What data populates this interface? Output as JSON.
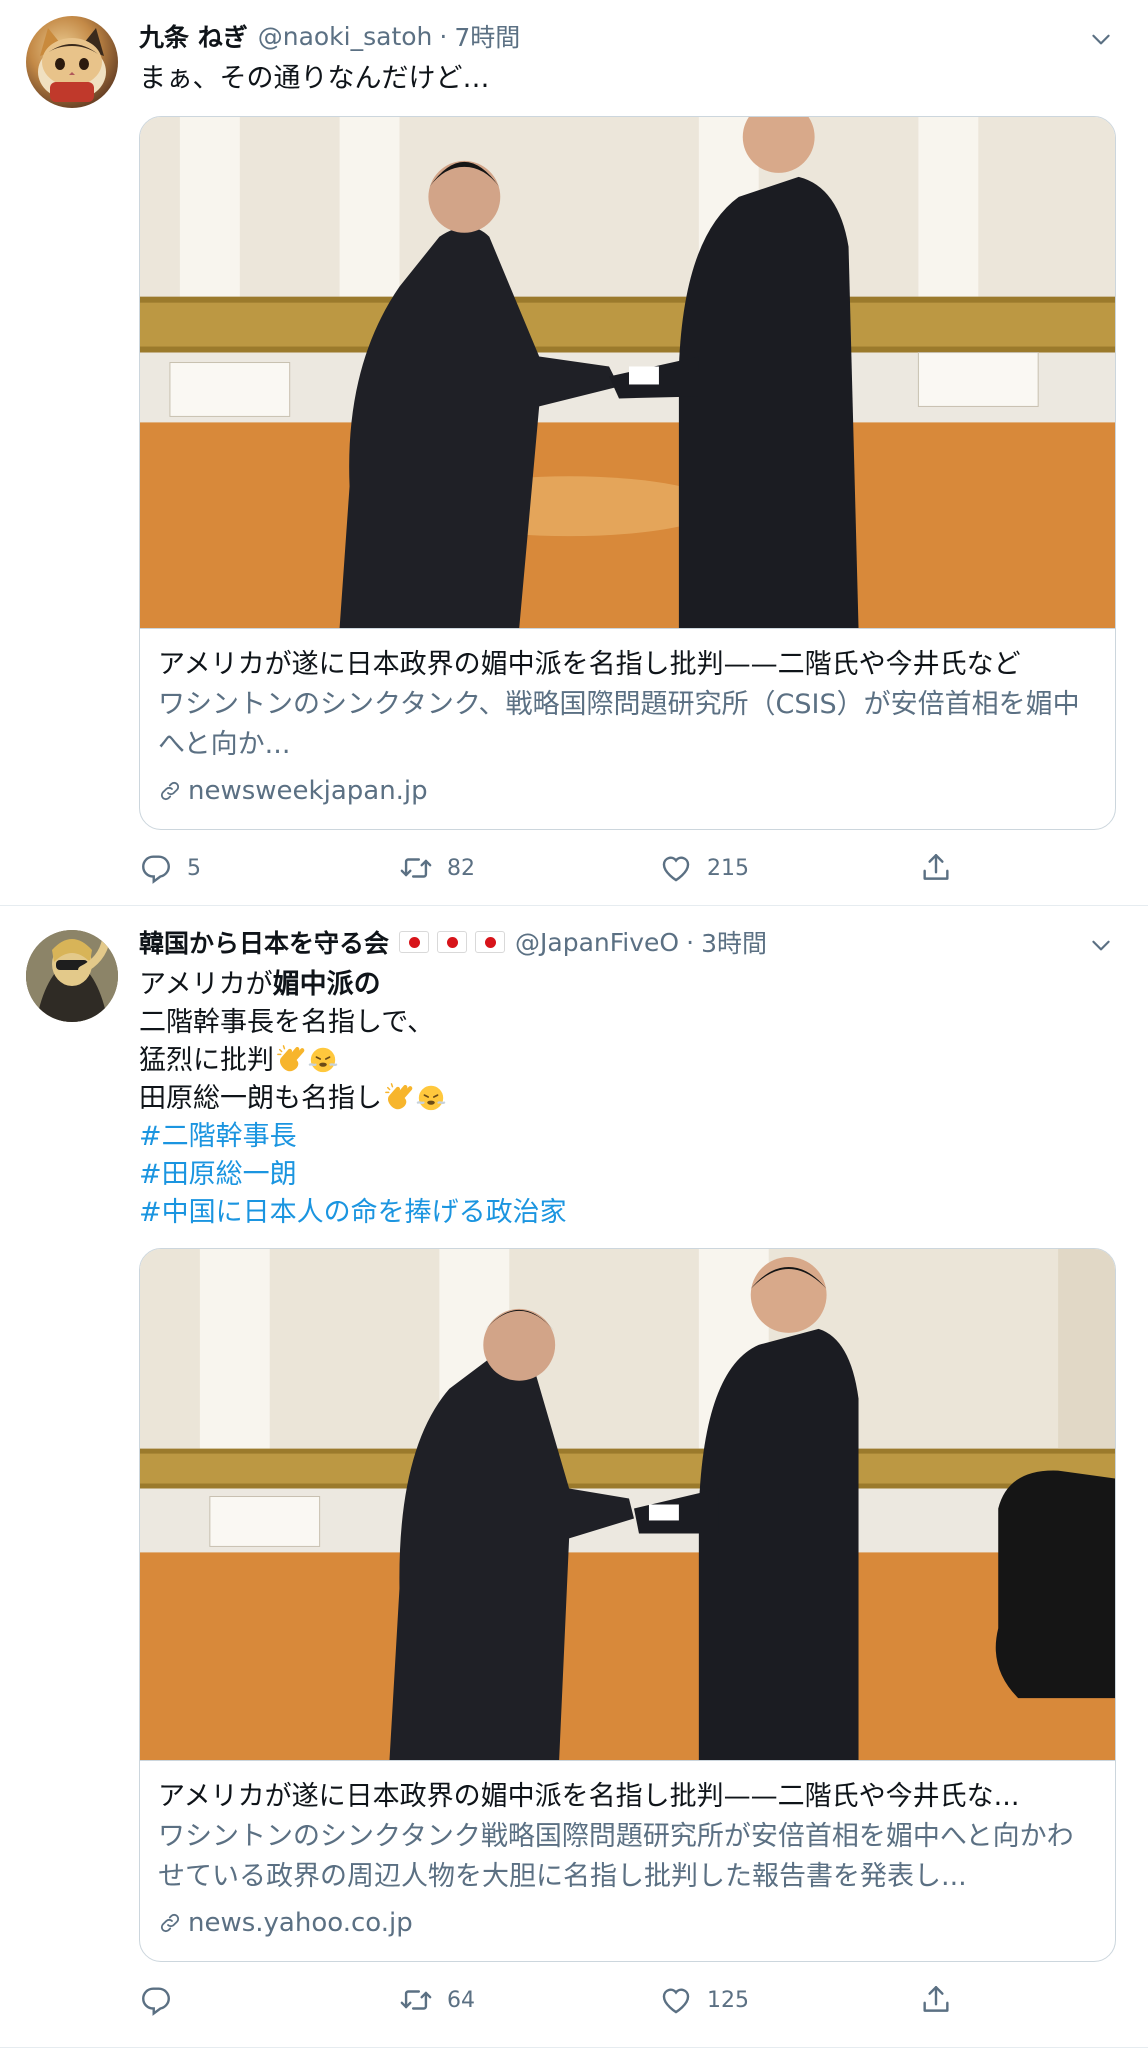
{
  "tweets": [
    {
      "display_name": "九条 ねぎ",
      "handle": "@naoki_satoh",
      "separator": "·",
      "time": "7時間",
      "text_lines": [
        "まぁ、その通りなんだけど…"
      ],
      "card": {
        "title": "アメリカが遂に日本政界の媚中派を名指し批判——二階氏や今井氏など",
        "description": "ワシントンのシンクタンク、戦略国際問題研究所（CSIS）が安倍首相を媚中へと向か...",
        "domain": "newsweekjapan.jp"
      },
      "actions": {
        "reply_count": "5",
        "retweet_count": "82",
        "like_count": "215"
      }
    },
    {
      "display_name": "韓国から日本を守る会",
      "handle": "@JapanFiveO",
      "separator": "·",
      "time": "3時間",
      "text": {
        "line1_prefix": "アメリカが",
        "line1_bold": "媚中派の",
        "line2": "二階幹事長を名指しで、",
        "line3": "猛烈に批判",
        "line4": "田原総一朗も名指し"
      },
      "hashtags": [
        "#二階幹事長",
        "#田原総一朗",
        "#中国に日本人の命を捧げる政治家"
      ],
      "card": {
        "title": "アメリカが遂に日本政界の媚中派を名指し批判——二階氏や今井氏な...",
        "description": "ワシントンのシンクタンク戦略国際問題研究所が安倍首相を媚中へと向かわせている政界の周辺人物を大胆に名指し批判した報告書を発表し...",
        "domain": "news.yahoo.co.jp"
      },
      "actions": {
        "reply_count": "",
        "retweet_count": "64",
        "like_count": "125"
      }
    }
  ],
  "icons": [
    "caret-down-icon",
    "reply-icon",
    "retweet-icon",
    "like-icon",
    "share-icon",
    "link-icon",
    "clap-emoji-icon",
    "steam-face-emoji-icon",
    "japan-flag-icon"
  ],
  "colors": {
    "text": "#0f1419",
    "secondary": "#5b7083",
    "hashtag": "#1b95e0",
    "border": "#ccd6dd",
    "flag_red": "#d7141a"
  }
}
